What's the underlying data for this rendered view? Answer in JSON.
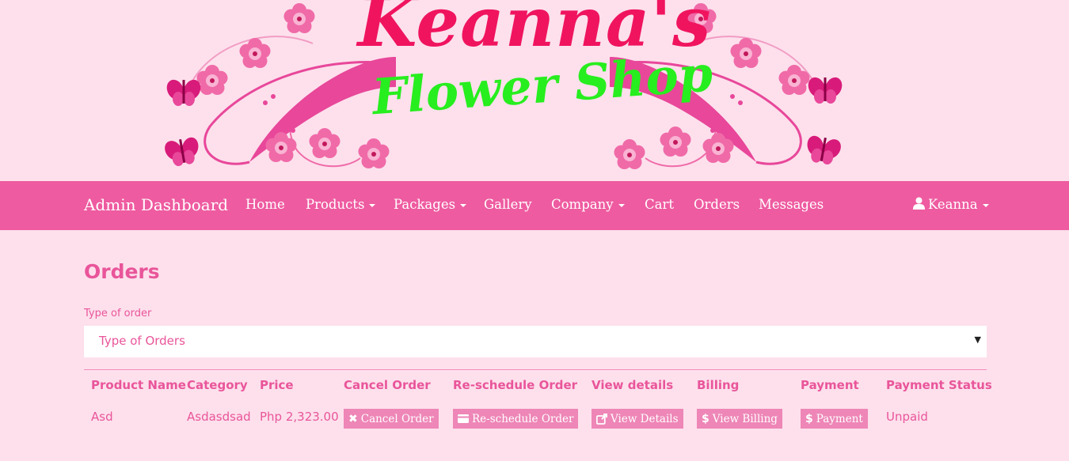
{
  "logo": {
    "title": "Keanna's",
    "subtitle": "Flower Shop"
  },
  "navbar": {
    "brand": "Admin Dashboard",
    "items": [
      {
        "label": "Home",
        "dropdown": false
      },
      {
        "label": "Products",
        "dropdown": true
      },
      {
        "label": "Packages",
        "dropdown": true
      },
      {
        "label": "Gallery",
        "dropdown": false
      },
      {
        "label": "Company",
        "dropdown": true
      },
      {
        "label": "Cart",
        "dropdown": false
      },
      {
        "label": "Orders",
        "dropdown": false
      },
      {
        "label": "Messages",
        "dropdown": false
      }
    ],
    "user": {
      "icon": "user-icon",
      "label": "Keanna",
      "dropdown": true
    }
  },
  "main": {
    "title": "Orders",
    "filter": {
      "label": "Type of order",
      "selected": "Type of Orders",
      "arrow": "▼"
    },
    "table": {
      "headers": [
        "Product Name",
        "Category",
        "Price",
        "Cancel Order",
        "Re-schedule Order",
        "View details",
        "Billing",
        "Payment",
        "Payment Status"
      ],
      "rows": [
        {
          "product_name": "Asd",
          "category": "Asdasdsad",
          "price": "Php 2,323.00",
          "cancel_button": {
            "icon": "times-icon",
            "label": "Cancel Order"
          },
          "reschedule_button": {
            "icon": "credit-card-icon",
            "label": "Re-schedule Order"
          },
          "details_button": {
            "icon": "external-link-icon",
            "label": "View Details"
          },
          "billing_button": {
            "icon": "dollar-icon",
            "label": "View Billing"
          },
          "payment_button": {
            "icon": "dollar-icon",
            "label": "Payment"
          },
          "payment_status": "Unpaid"
        }
      ]
    }
  },
  "colors": {
    "page_bg": "#fde0ec",
    "navbar_bg": "#ee5ba0",
    "accent_text": "#e9559a",
    "button_bg": "#ee86b7",
    "logo_title": "#f0145f",
    "logo_subtitle": "#27ee1e"
  }
}
